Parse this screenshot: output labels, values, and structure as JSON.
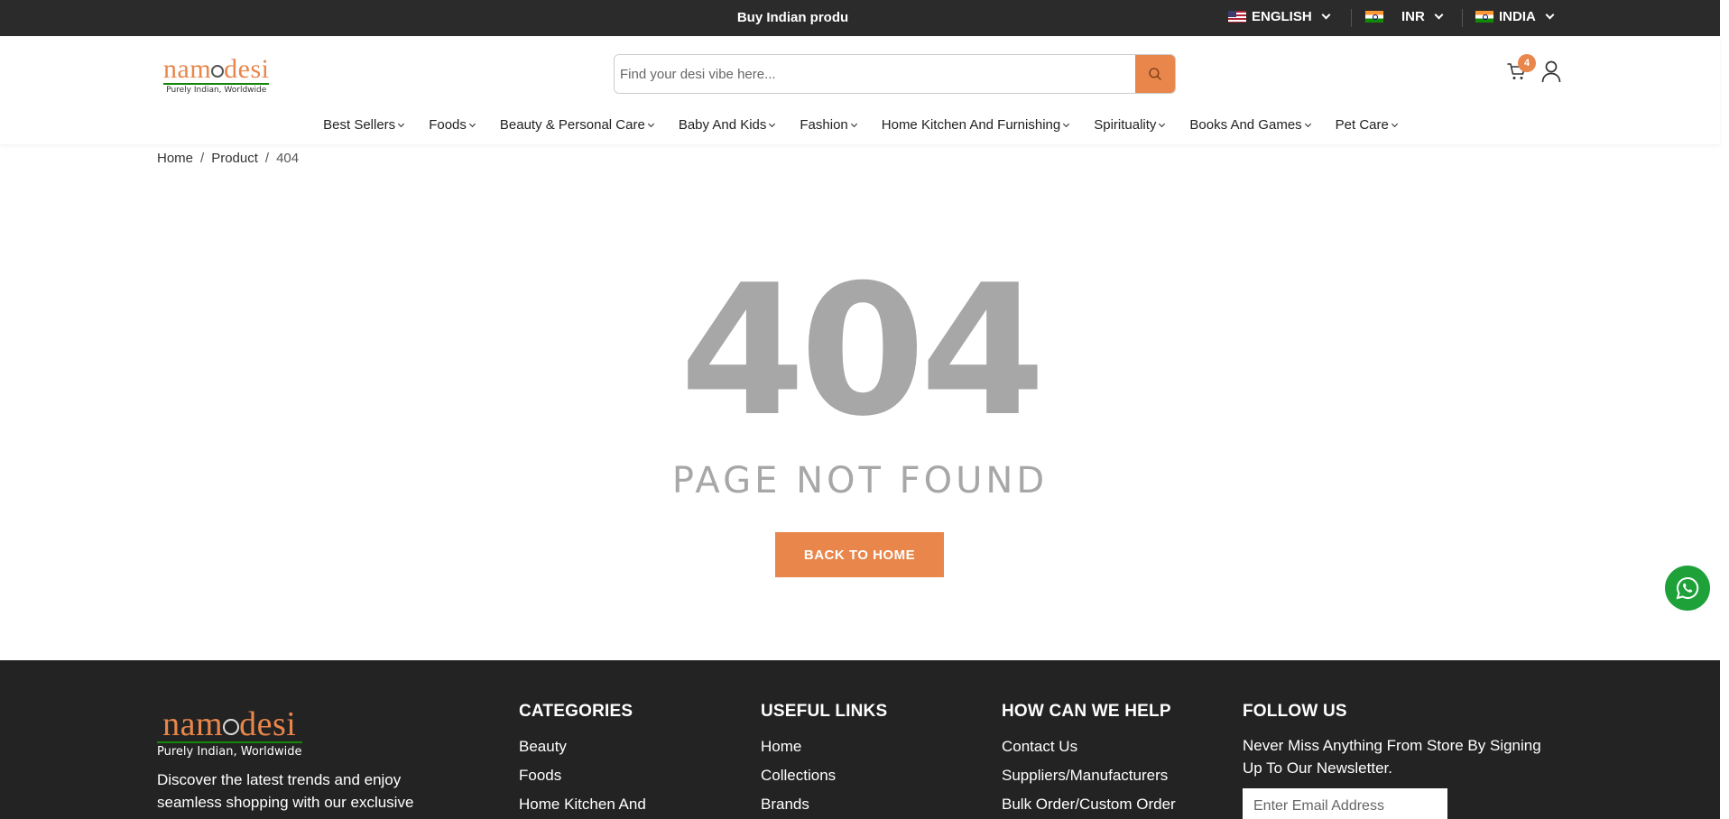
{
  "topbar": {
    "promo": "Buy Indian produ",
    "language": "ENGLISH",
    "currency": "INR",
    "country": "INDIA"
  },
  "header": {
    "logo_text": "namodesi",
    "logo_tagline": "Purely Indian, Worldwide",
    "search_placeholder": "Find your desi vibe here...",
    "cart_count": "4"
  },
  "nav": {
    "items": [
      "Best Sellers",
      "Foods",
      "Beauty & Personal Care",
      "Baby And Kids",
      "Fashion",
      "Home Kitchen And Furnishing",
      "Spirituality",
      "Books And Games",
      "Pet Care"
    ]
  },
  "breadcrumb": {
    "home": "Home",
    "product": "Product",
    "current": "404",
    "separator": "/"
  },
  "error": {
    "code": "404",
    "message": "PAGE NOT FOUND",
    "button": "BACK TO HOME"
  },
  "footer": {
    "logo_text": "namodesi",
    "logo_tagline": "Purely Indian, Worldwide",
    "description": "Discover the latest trends and enjoy seamless shopping with our exclusive",
    "categories": {
      "title": "CATEGORIES",
      "links": [
        "Beauty",
        "Foods",
        "Home Kitchen And"
      ]
    },
    "useful_links": {
      "title": "USEFUL LINKS",
      "links": [
        "Home",
        "Collections",
        "Brands"
      ]
    },
    "help": {
      "title": "HOW CAN WE HELP",
      "links": [
        "Contact Us",
        "Suppliers/Manufacturers",
        "Bulk Order/Custom Order"
      ]
    },
    "follow": {
      "title": "FOLLOW US",
      "text": "Never Miss Anything From Store By Signing Up To Our Newsletter.",
      "email_placeholder": "Enter Email Address"
    }
  },
  "colors": {
    "accent": "#e8864b",
    "topbar_bg": "#2b2b2b",
    "footer_bg": "#232323",
    "error_text": "#a7a7a7",
    "whatsapp": "#1fa13a"
  },
  "icons": [
    "us-flag-icon",
    "india-flag-icon",
    "chevron-down-icon",
    "search-icon",
    "cart-icon",
    "user-icon",
    "whatsapp-icon"
  ]
}
